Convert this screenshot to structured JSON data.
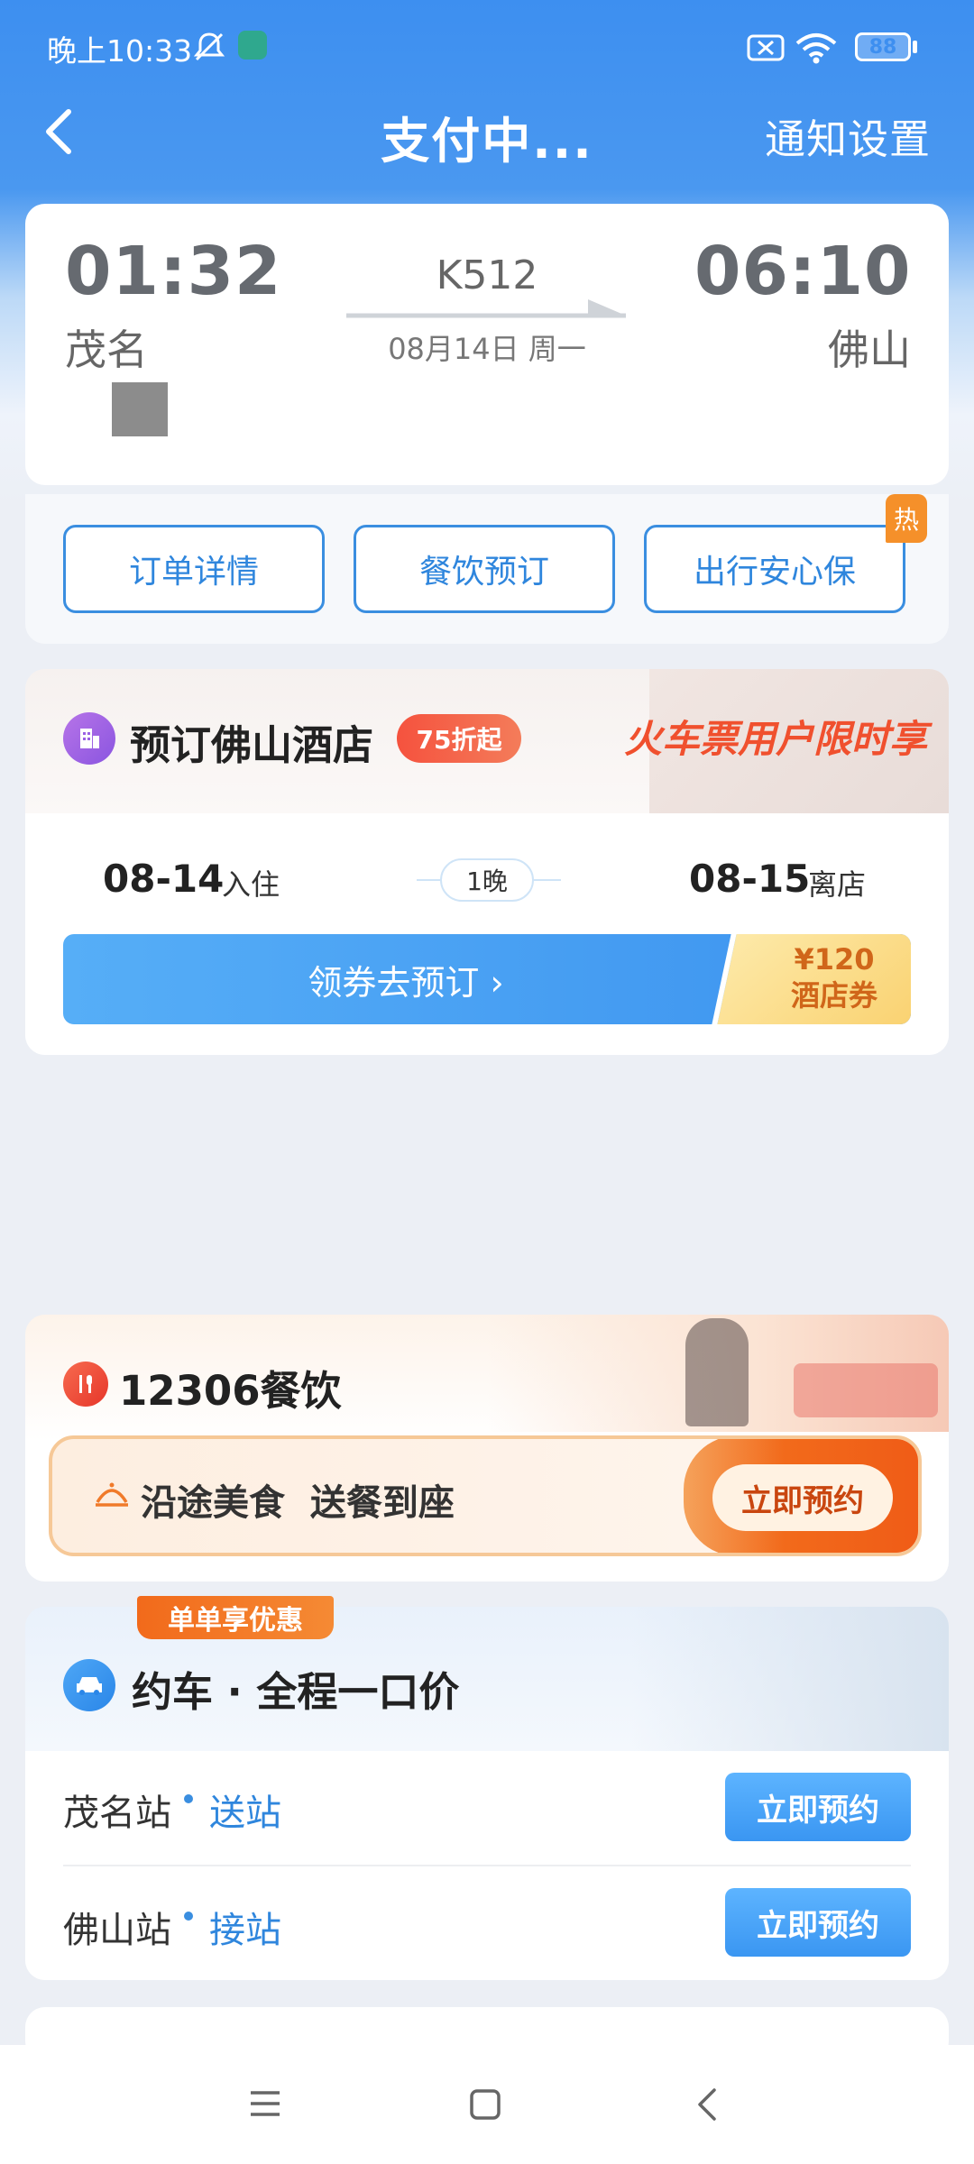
{
  "status_bar": {
    "time": "晚上10:33",
    "battery": "88"
  },
  "nav": {
    "title": "支付中...",
    "right_label": "通知设置"
  },
  "trip": {
    "depart_time": "01:32",
    "depart_city": "茂名",
    "arrive_time": "06:10",
    "arrive_city": "佛山",
    "train_no": "K512",
    "date": "08月14日 周一"
  },
  "actions": [
    {
      "label": "订单详情"
    },
    {
      "label": "餐饮预订"
    },
    {
      "label": "出行安心保",
      "badge": "热"
    }
  ],
  "hotel": {
    "title": "预订佛山酒店",
    "discount": "75折起",
    "slogan": "火车票用户限时享",
    "checkin_date": "08-14",
    "checkin_label": "入住",
    "nights": "1晚",
    "checkout_date": "08-15",
    "checkout_label": "离店",
    "book_label": "领券去预订 ›",
    "coupon_amount": "¥120",
    "coupon_label": "酒店券"
  },
  "catering": {
    "title": "12306餐饮",
    "banner_text": "沿途美食  送餐到座",
    "button_label": "立即预约"
  },
  "car": {
    "ribbon": "单单享优惠",
    "title": "约车 · 全程一口价",
    "rows": [
      {
        "station": "茂名站",
        "type": "送站",
        "button": "立即预约"
      },
      {
        "station": "佛山站",
        "type": "接站",
        "button": "立即预约"
      }
    ]
  },
  "colors": {
    "primary_blue": "#3a8ee0",
    "orange": "#f26a1b",
    "hot_red": "#f05a3a"
  }
}
